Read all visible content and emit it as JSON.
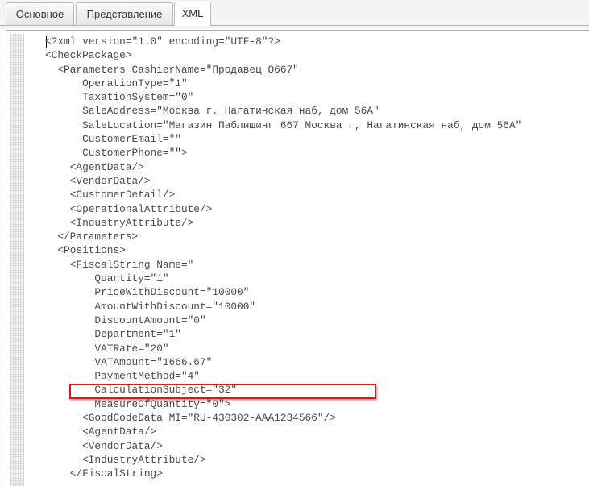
{
  "tabs": [
    {
      "label": "Основное",
      "active": false
    },
    {
      "label": "Представление",
      "active": false
    },
    {
      "label": "XML",
      "active": true
    }
  ],
  "editor": {
    "lines": [
      "<?xml version=\"1.0\" encoding=\"UTF-8\"?>",
      "<CheckPackage>",
      "  <Parameters CashierName=\"Продавец О667\"",
      "      OperationType=\"1\"",
      "      TaxationSystem=\"0\"",
      "      SaleAddress=\"Москва г, Нагатинская наб, дом 56А\"",
      "      SaleLocation=\"Магазин Паблишинг 667 Москва г, Нагатинская наб, дом 56А\"",
      "      CustomerEmail=\"\"",
      "      CustomerPhone=\"\">",
      "    <AgentData/>",
      "    <VendorData/>",
      "    <CustomerDetail/>",
      "    <OperationalAttribute/>",
      "    <IndustryAttribute/>",
      "  </Parameters>",
      "  <Positions>",
      "    <FiscalString Name=\"",
      "        Quantity=\"1\"",
      "        PriceWithDiscount=\"10000\"",
      "        AmountWithDiscount=\"10000\"",
      "        DiscountAmount=\"0\"",
      "        Department=\"1\"",
      "        VATRate=\"20\"",
      "        VATAmount=\"1666.67\"",
      "        PaymentMethod=\"4\"",
      "        CalculationSubject=\"32\"",
      "        MeasureOfQuantity=\"0\">",
      "      <GoodCodeData MI=\"RU-430302-AAA1234566\"/>",
      "      <AgentData/>",
      "      <VendorData/>",
      "      <IndustryAttribute/>",
      "    </FiscalString>"
    ]
  },
  "colors": {
    "highlight": "#e3141b"
  }
}
